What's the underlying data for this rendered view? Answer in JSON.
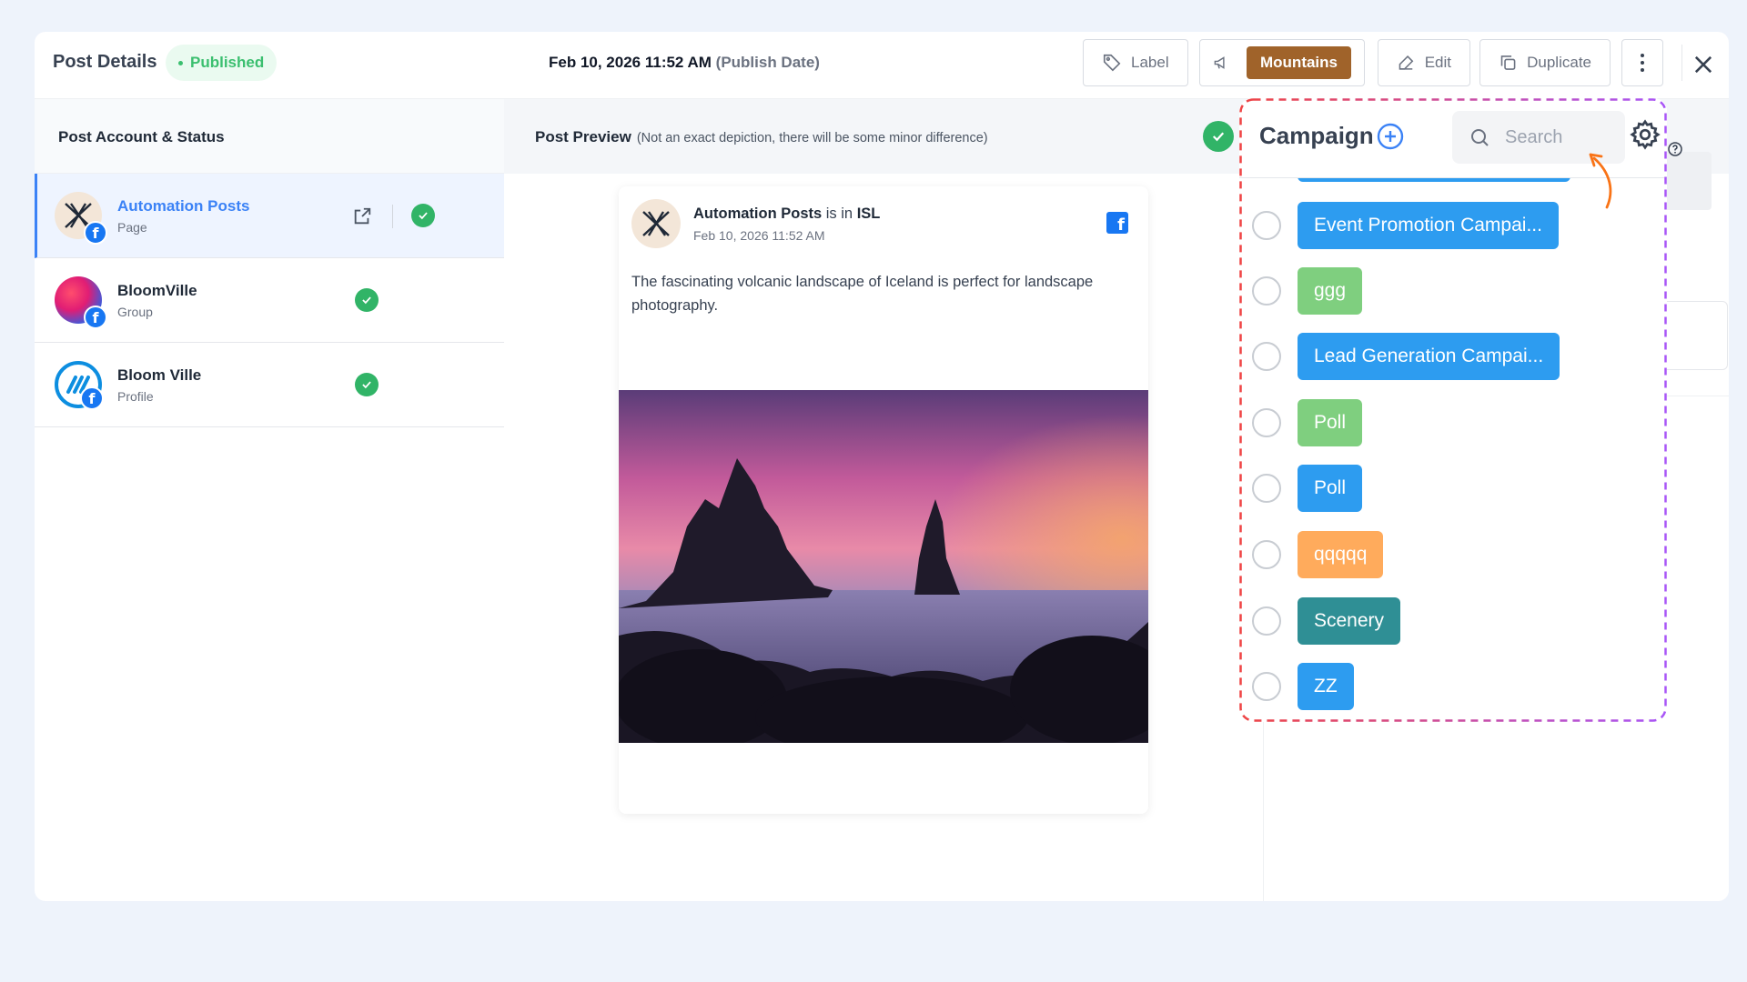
{
  "header": {
    "title": "Post Details",
    "status": "Published",
    "publish_date": "Feb 10, 2026 11:52 AM",
    "publish_date_suffix": "(Publish Date)",
    "label_button": "Label",
    "campaign_button": "Mountains",
    "edit_button": "Edit",
    "duplicate_button": "Duplicate"
  },
  "left": {
    "heading": "Post Account & Status",
    "accounts": [
      {
        "name": "Automation Posts",
        "type": "Page"
      },
      {
        "name": "BloomVille",
        "type": "Group"
      },
      {
        "name": "Bloom Ville",
        "type": "Profile"
      }
    ]
  },
  "preview": {
    "heading": "Post Preview",
    "subheading": "(Not an exact depiction, there will be some minor difference)",
    "author": "Automation Posts",
    "author_mid": "is in",
    "location": "ISL",
    "date": "Feb 10, 2026 11:52 AM",
    "body": "The fascinating volcanic landscape of Iceland is perfect for landscape photography."
  },
  "campaign": {
    "title": "Campaign",
    "search_placeholder": "Search",
    "items": [
      {
        "label": "Event Promotion Campai...",
        "color": "#2d9cf0"
      },
      {
        "label": "ggg",
        "color": "#7fcf7f"
      },
      {
        "label": "Lead Generation Campai...",
        "color": "#2d9cf0"
      },
      {
        "label": "Poll",
        "color": "#7fcf7f"
      },
      {
        "label": "Poll",
        "color": "#2d9cf0"
      },
      {
        "label": "qqqqq",
        "color": "#ffab5c"
      },
      {
        "label": "Scenery",
        "color": "#2f8f95"
      },
      {
        "label": "ZZ",
        "color": "#2d9cf0"
      }
    ]
  },
  "colors": {
    "accent": "#3b82f6",
    "success": "#31b467",
    "campaign_pill": "#a0632a",
    "facebook": "#1877f2"
  },
  "icons": [
    "tag-icon",
    "megaphone-icon",
    "edit-icon",
    "duplicate-icon",
    "kebab-icon",
    "close-icon",
    "external-link-icon",
    "check-icon",
    "plus-circle-icon",
    "search-icon",
    "gear-icon",
    "help-icon",
    "facebook-icon"
  ]
}
